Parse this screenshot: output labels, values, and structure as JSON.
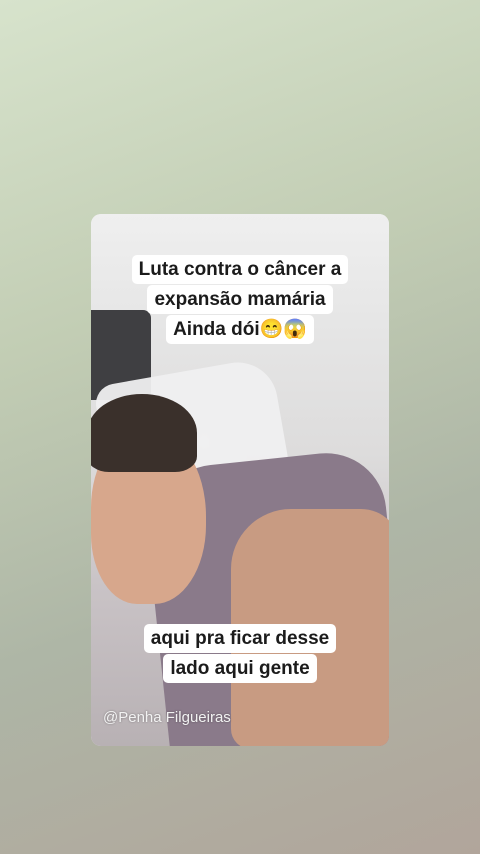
{
  "story": {
    "caption_top": {
      "line1": "Luta contra o câncer a",
      "line2": "expansão mamária",
      "line3": "Ainda dói😁😱"
    },
    "caption_bottom": {
      "line1": "aqui pra ficar desse",
      "line2": "lado aqui gente"
    },
    "watermark": "@Penha Filgueiras"
  },
  "colors": {
    "background_top": "#d7e3cc",
    "background_bottom": "#b1a59b",
    "caption_bg": "#ffffff",
    "caption_text": "#1b1b1b"
  }
}
